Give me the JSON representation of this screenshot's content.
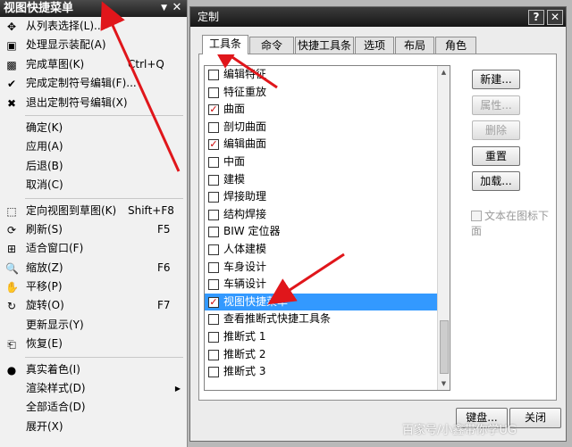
{
  "menu": {
    "title": "视图快捷菜单",
    "items": [
      {
        "icon": "✥",
        "icon_name": "list-select-icon",
        "label": "从列表选择(L)...",
        "shortcut": ""
      },
      {
        "icon": "▣",
        "icon_name": "display-assembly-icon",
        "label": "处理显示装配(A)",
        "shortcut": ""
      },
      {
        "icon": "▩",
        "icon_name": "finish-sketch-icon",
        "label": "完成草图(K)",
        "shortcut": "Ctrl+Q"
      },
      {
        "icon": "✔",
        "icon_name": "finish-symbol-edit-icon",
        "label": "完成定制符号编辑(F)...",
        "shortcut": ""
      },
      {
        "icon": "✖",
        "icon_name": "exit-symbol-edit-icon",
        "label": "退出定制符号编辑(X)",
        "shortcut": ""
      },
      {
        "sep": true
      },
      {
        "icon": "",
        "icon_name": "",
        "label": "确定(K)",
        "shortcut": ""
      },
      {
        "icon": "",
        "icon_name": "",
        "label": "应用(A)",
        "shortcut": ""
      },
      {
        "icon": "",
        "icon_name": "",
        "label": "后退(B)",
        "shortcut": ""
      },
      {
        "icon": "",
        "icon_name": "",
        "label": "取消(C)",
        "shortcut": ""
      },
      {
        "sep": true
      },
      {
        "icon": "⬚",
        "icon_name": "orient-view-icon",
        "label": "定向视图到草图(K)",
        "shortcut": "Shift+F8"
      },
      {
        "icon": "⟳",
        "icon_name": "refresh-icon",
        "label": "刷新(S)",
        "shortcut": "F5"
      },
      {
        "icon": "⊞",
        "icon_name": "fit-icon",
        "label": "适合窗口(F)",
        "shortcut": ""
      },
      {
        "icon": "🔍",
        "icon_name": "zoom-icon",
        "label": "缩放(Z)",
        "shortcut": "F6"
      },
      {
        "icon": "✋",
        "icon_name": "pan-icon",
        "label": "平移(P)",
        "shortcut": ""
      },
      {
        "icon": "↻",
        "icon_name": "rotate-icon",
        "label": "旋转(O)",
        "shortcut": "F7"
      },
      {
        "icon": "",
        "icon_name": "",
        "label": "更新显示(Y)",
        "shortcut": ""
      },
      {
        "icon": "⎗",
        "icon_name": "restore-icon",
        "label": "恢复(E)",
        "shortcut": ""
      },
      {
        "sep": true
      },
      {
        "icon": "●",
        "icon_name": "true-shading-icon",
        "label": "真实着色(I)",
        "shortcut": ""
      },
      {
        "icon": "",
        "icon_name": "",
        "label": "渲染样式(D)",
        "shortcut": "",
        "submenu": true
      },
      {
        "icon": "",
        "icon_name": "",
        "label": "全部适合(D)",
        "shortcut": ""
      },
      {
        "icon": "",
        "icon_name": "",
        "label": "展开(X)",
        "shortcut": ""
      }
    ]
  },
  "dialog": {
    "title": "定制",
    "help": "?",
    "close": "✕",
    "tabs": [
      "工具条",
      "命令",
      "快捷工具条",
      "选项",
      "布局",
      "角色"
    ],
    "list": [
      {
        "label": "编辑特征",
        "checked": false
      },
      {
        "label": "特征重放",
        "checked": false
      },
      {
        "label": "曲面",
        "checked": true
      },
      {
        "label": "剖切曲面",
        "checked": false
      },
      {
        "label": "编辑曲面",
        "checked": true
      },
      {
        "label": "中面",
        "checked": false
      },
      {
        "label": "建模",
        "checked": false
      },
      {
        "label": "焊接助理",
        "checked": false
      },
      {
        "label": "结构焊接",
        "checked": false
      },
      {
        "label": "BIW 定位器",
        "checked": false
      },
      {
        "label": "人体建模",
        "checked": false
      },
      {
        "label": "车身设计",
        "checked": false
      },
      {
        "label": "车辆设计",
        "checked": false
      },
      {
        "label": "视图快捷菜单",
        "checked": true,
        "selected": true
      },
      {
        "label": "查看推断式快捷工具条",
        "checked": false
      },
      {
        "label": "推断式 1",
        "checked": false
      },
      {
        "label": "推断式 2",
        "checked": false
      },
      {
        "label": "推断式 3",
        "checked": false
      }
    ],
    "buttons": [
      {
        "label": "新建...",
        "enabled": true
      },
      {
        "label": "属性...",
        "enabled": false
      },
      {
        "label": "删除",
        "enabled": false
      },
      {
        "label": "重置",
        "enabled": true
      },
      {
        "label": "加载...",
        "enabled": true
      }
    ],
    "text_below_icon": "文本在图标下面",
    "keyboard": "键盘...",
    "close_label": "关闭"
  },
  "watermark": "百家号/小鑫带你学UG",
  "colors": {
    "selection": "#3399ff",
    "arrow": "#e0161b",
    "check": "#cc0000"
  }
}
